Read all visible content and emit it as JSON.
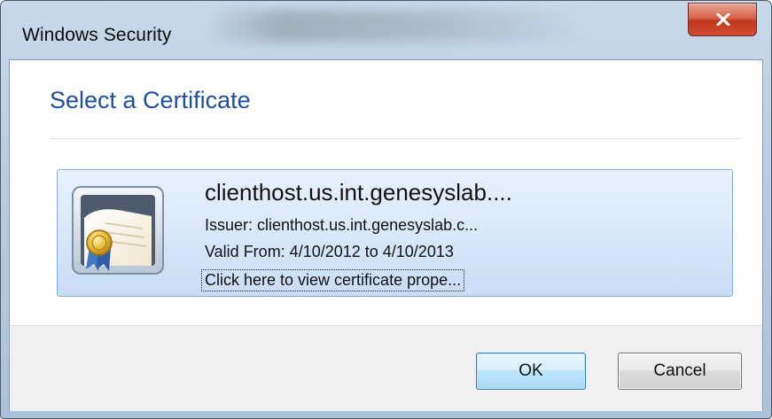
{
  "window": {
    "title": "Windows Security",
    "close_label": "X"
  },
  "dialog": {
    "heading": "Select a Certificate",
    "certificate": {
      "name": "clienthost.us.int.genesyslab....",
      "issuer": "Issuer: clienthost.us.int.genesyslab.c...",
      "valid": "Valid From: 4/10/2012 to 4/10/2013",
      "link": "Click here to view certificate prope..."
    }
  },
  "footer": {
    "ok_label": "OK",
    "cancel_label": "Cancel"
  },
  "colors": {
    "heading": "#1e4fa0",
    "close_button": "#c1361e",
    "tile_border": "#84acdd",
    "default_button_border": "#3c7fb1"
  }
}
